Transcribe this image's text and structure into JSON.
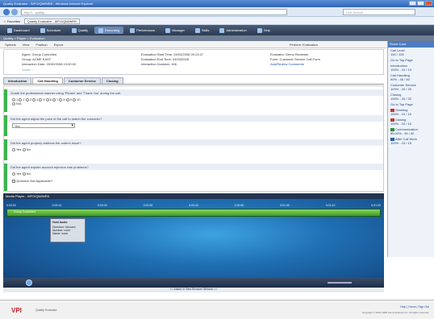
{
  "window": {
    "title": "Quality Evaluator - WFO/QM/WEB - Windows Internet Explorer"
  },
  "browser": {
    "url": "http://...quality...",
    "search_placeholder": "Live Search",
    "favorites_label": "Favorites",
    "tab_label": "Quality Evaluator - WFO/QM/WEB"
  },
  "nav": {
    "tabs": [
      "Dashboard",
      "Scheduler",
      "Quality",
      "Recording",
      "Performance",
      "Manager",
      "Skills",
      "Administration",
      "Help"
    ],
    "active_index": 3
  },
  "crumb": "Quality > Player > Evaluation",
  "toolbar": {
    "items": [
      "Options",
      "View",
      "Position",
      "Export"
    ],
    "form_label": "Perform: Evaluation"
  },
  "info": {
    "agent": "Agent: Group Controlled",
    "group": "Group: ACME EAST",
    "interaction_date": "Interaction Date: 03/30/2008 10:00:00",
    "score": "Score: --",
    "eval_start": "Evaluation Start Time: 04/03/2008 09:13:47",
    "eval_end": "Evaluation End Time: 04/03/2008",
    "duration": "Interaction Duration: 166",
    "evaluator": "Evaluator: Demo Reviewer",
    "form": "Form: Customer Service Call Form",
    "comments": "Add/Review Comments"
  },
  "tabs": [
    "Introduction",
    "Call Handling",
    "Customer Service",
    "Closing"
  ],
  "active_tab": 1,
  "questions": [
    {
      "text": "Grade the professional manner using 'Please' and 'Thank You' during the call.",
      "options": [
        "1",
        "2",
        "3",
        "4",
        "5",
        "6",
        "7",
        "8",
        "9",
        "10"
      ],
      "na": "N/A"
    },
    {
      "text": "Did the agent adjust the pace of the call to match the customer?",
      "select": "Yes"
    },
    {
      "text": "Did the agent properly address the caller's issue?",
      "options": [
        "Yes",
        "No"
      ]
    },
    {
      "text": "Did the agent explain account rejection rate problems?",
      "options": [
        "Yes",
        "No"
      ],
      "checkbox": "Question Not Applicable?"
    }
  ],
  "right_panel": {
    "header": "Score Card",
    "items": [
      {
        "label": "Call Level",
        "value": "100 / 100",
        "status": ""
      },
      {
        "label": "Go to Top Page",
        "value": "",
        "status": ""
      },
      {
        "label": "Introduction",
        "value": "100% - 10 / 10",
        "status": ""
      },
      {
        "label": "Call Handling",
        "value": "90% - 45 / 50",
        "status": ""
      },
      {
        "label": "Customer Service",
        "value": "100% - 20 / 20",
        "status": ""
      },
      {
        "label": "Closing",
        "value": "100% - 20 / 20",
        "status": ""
      },
      {
        "label": "Go to Top Page",
        "value": "",
        "status": ""
      },
      {
        "label": "Greeting",
        "value": "100% - 10 / 10",
        "status": "red"
      },
      {
        "label": "Closing",
        "value": "100% - 10 / 10",
        "status": "red"
      },
      {
        "label": "Communication",
        "value": "85.00% - 34 / 40",
        "status": "green"
      },
      {
        "label": "After Call Work",
        "value": "100% - 15 / 15",
        "status": "blue"
      }
    ]
  },
  "player": {
    "title": "Media Player - WFO/QM/WEB",
    "track_label": "Group Controlled",
    "times": [
      "0:00:00",
      "0:00:10",
      "0:00:20",
      "0:00:30",
      "0:00:40",
      "0:00:50",
      "0:01:00",
      "0:01:10",
      "0:01:20"
    ],
    "popup_title": "Hold Audio",
    "popup_lines": [
      "Direction: Inbound",
      "Number: none",
      "Name: none"
    ],
    "detach": "<< Attach In New Browser Window >>"
  },
  "footer": {
    "brand": "VPI",
    "product": "Quality Evaluator",
    "links": "Help | Home | Sign Out",
    "copyright": "Copyright © 2007-2008 Verint Systems Inc. All rights reserved."
  },
  "colors": {
    "nav": "#2c3a52",
    "wave": "#3e9c25",
    "accent": "#39b54a",
    "player_bg": "#1f6fb3"
  }
}
